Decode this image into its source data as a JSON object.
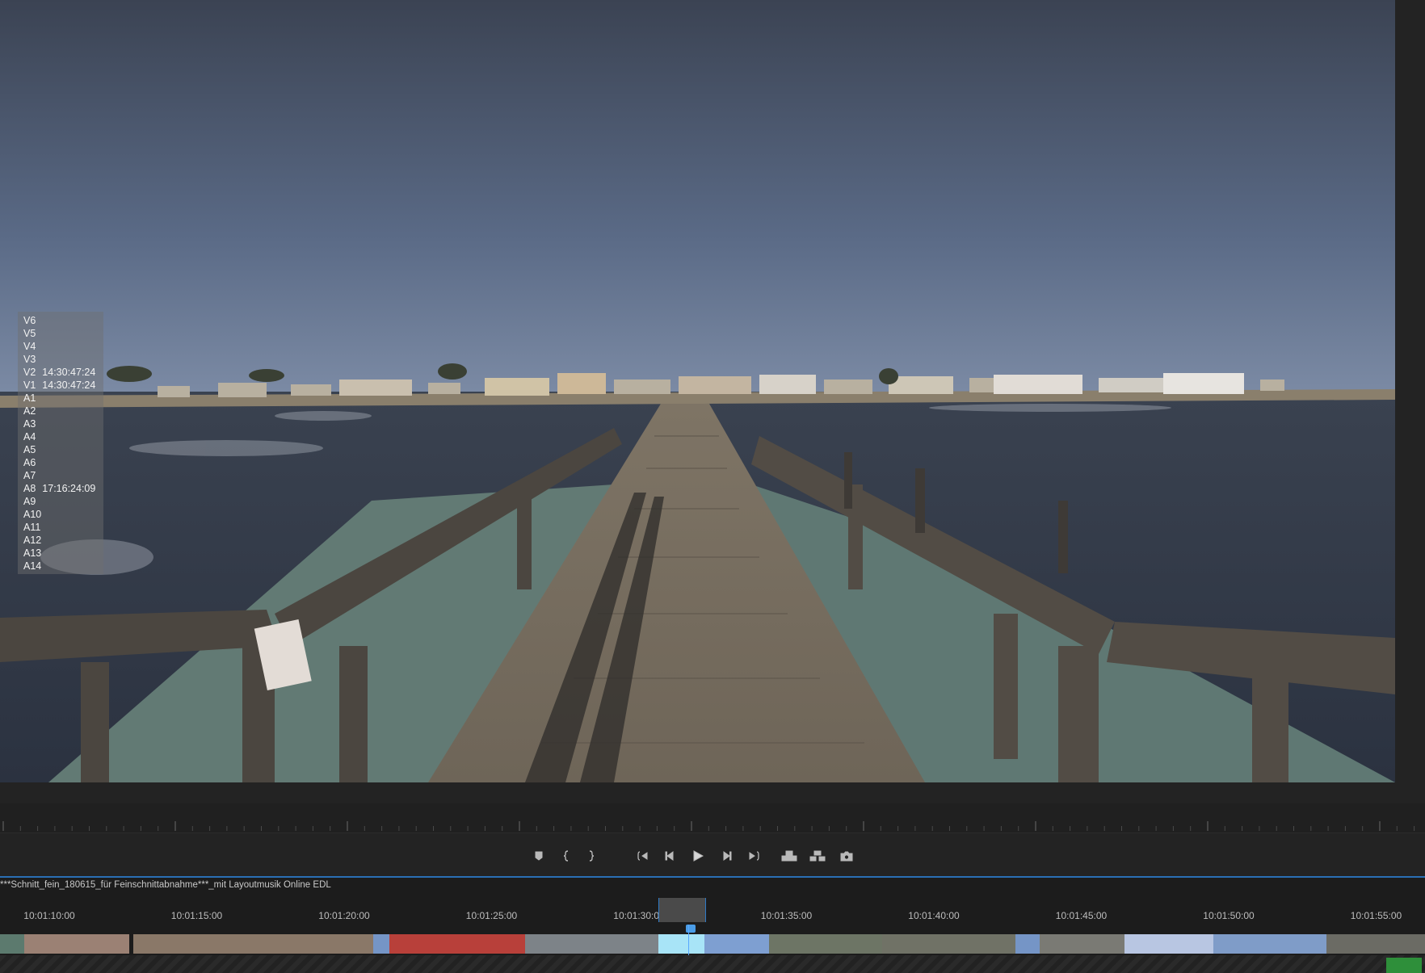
{
  "track_overlay": {
    "rows": [
      {
        "track": "V6",
        "timecode": ""
      },
      {
        "track": "V5",
        "timecode": ""
      },
      {
        "track": "V4",
        "timecode": ""
      },
      {
        "track": "V3",
        "timecode": ""
      },
      {
        "track": "V2",
        "timecode": "14:30:47:24"
      },
      {
        "track": "V1",
        "timecode": "14:30:47:24"
      },
      {
        "track": "A1",
        "timecode": ""
      },
      {
        "track": "A2",
        "timecode": ""
      },
      {
        "track": "A3",
        "timecode": ""
      },
      {
        "track": "A4",
        "timecode": ""
      },
      {
        "track": "A5",
        "timecode": ""
      },
      {
        "track": "A6",
        "timecode": ""
      },
      {
        "track": "A7",
        "timecode": ""
      },
      {
        "track": "A8",
        "timecode": "17:16:24:09"
      },
      {
        "track": "A9",
        "timecode": ""
      },
      {
        "track": "A10",
        "timecode": ""
      },
      {
        "track": "A11",
        "timecode": ""
      },
      {
        "track": "A12",
        "timecode": ""
      },
      {
        "track": "A13",
        "timecode": ""
      },
      {
        "track": "A14",
        "timecode": ""
      }
    ]
  },
  "transport": {
    "buttons": [
      {
        "name": "add-marker-button",
        "icon": "marker-icon"
      },
      {
        "name": "mark-in-button",
        "icon": "mark-in-icon"
      },
      {
        "name": "mark-out-button",
        "icon": "mark-out-icon"
      },
      {
        "name": "go-to-in-button",
        "icon": "go-to-in-icon"
      },
      {
        "name": "step-back-button",
        "icon": "step-back-icon"
      },
      {
        "name": "play-button",
        "icon": "play-icon"
      },
      {
        "name": "step-forward-button",
        "icon": "step-forward-icon"
      },
      {
        "name": "go-to-out-button",
        "icon": "go-to-out-icon"
      },
      {
        "name": "lift-button",
        "icon": "lift-icon"
      },
      {
        "name": "extract-button",
        "icon": "extract-icon"
      },
      {
        "name": "export-frame-button",
        "icon": "camera-icon"
      }
    ]
  },
  "timeline": {
    "sequence_title": "***Schnitt_fein_180615_für Feinschnittabnahme***_mit Layoutmusik Online EDL",
    "ruler_labels": [
      "10:01:10:00",
      "10:01:15:00",
      "10:01:20:00",
      "10:01:25:00",
      "10:01:30:00",
      "10:01:35:00",
      "10:01:40:00",
      "10:01:45:00",
      "10:01:50:00",
      "10:01:55:00"
    ]
  },
  "colors": {
    "panel_bg": "#232323",
    "timeline_bg": "#1c1c1c",
    "accent_blue": "#2f79c4",
    "selected_clip": "#a8e4f7",
    "clip_blue": "#7e9fd1",
    "wf_badge": "#2e8f3a"
  }
}
